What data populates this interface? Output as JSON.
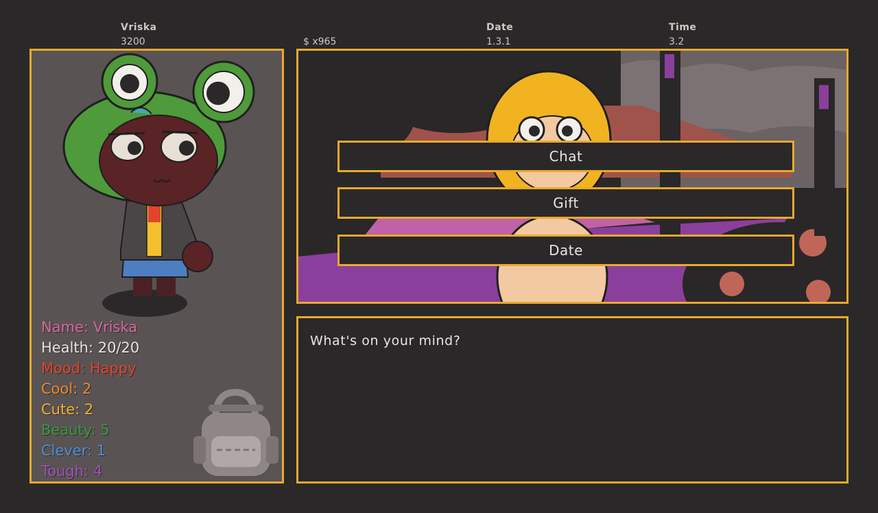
{
  "hud": {
    "name_label": "Vriska",
    "score": "3200",
    "money": "$ x965",
    "date_label": "Date",
    "date_value": "1.3.1",
    "time_label": "Time",
    "time_value": "3.2"
  },
  "stats": [
    {
      "text": "Name: Vriska",
      "color": "#d9679e"
    },
    {
      "text": "Health: 20/20",
      "color": "#eae5e0"
    },
    {
      "text": "Mood: Happy",
      "color": "#e2452c"
    },
    {
      "text": "Cool: 2",
      "color": "#ec8a2c"
    },
    {
      "text": "Cute: 2",
      "color": "#f1b332"
    },
    {
      "text": "Beauty: 5",
      "color": "#3a9a3c"
    },
    {
      "text": "Clever: 1",
      "color": "#4f8fd6"
    },
    {
      "text": "Tough: 4",
      "color": "#a052b8"
    }
  ],
  "menu": {
    "chat": "Chat",
    "gift": "Gift",
    "date": "Date"
  },
  "dialog": {
    "text": "What's on your mind?"
  },
  "icons": {
    "backpack": "backpack-icon"
  },
  "colors": {
    "accent_border": "#e9a92b",
    "background": "#2b2829",
    "panel": "#595354"
  }
}
